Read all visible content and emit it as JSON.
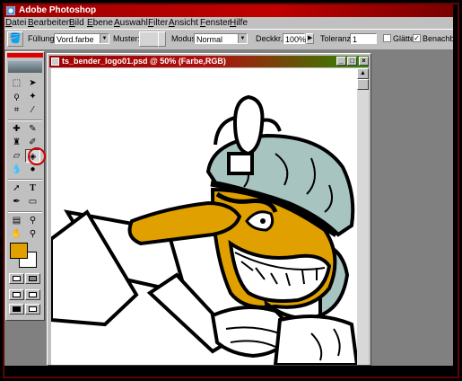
{
  "app": {
    "title": "Adobe Photoshop"
  },
  "menu": {
    "items": [
      "Datei",
      "Bearbeiten",
      "Bild",
      "Ebene",
      "Auswahl",
      "Filter",
      "Ansicht",
      "Fenster",
      "Hilfe"
    ]
  },
  "options_bar": {
    "fill_label": "Füllung:",
    "fill_value": "Vord.farbe",
    "pattern_label": "Muster:",
    "mode_label": "Modus:",
    "mode_value": "Normal",
    "opacity_label": "Deckkr.:",
    "opacity_value": "100%",
    "tolerance_label": "Toleranz:",
    "tolerance_value": "1",
    "antialias_label": "Glätten",
    "antialias_checked": false,
    "contiguous_label": "Benachbart",
    "contiguous_checked": true
  },
  "toolbox": {
    "active_tool": "paint-bucket",
    "foreground_color": "#e0a000",
    "background_color": "#ffffff"
  },
  "document": {
    "title": "ts_bender_logo01.psd @ 50% (Farbe,RGB)",
    "zoom": "50%",
    "color_mode": "Farbe,RGB"
  },
  "colors": {
    "title_red": "#b00000",
    "skin_orange": "#e0a000",
    "cap_teal": "#a8c4c0",
    "highlight": "#d00000"
  }
}
